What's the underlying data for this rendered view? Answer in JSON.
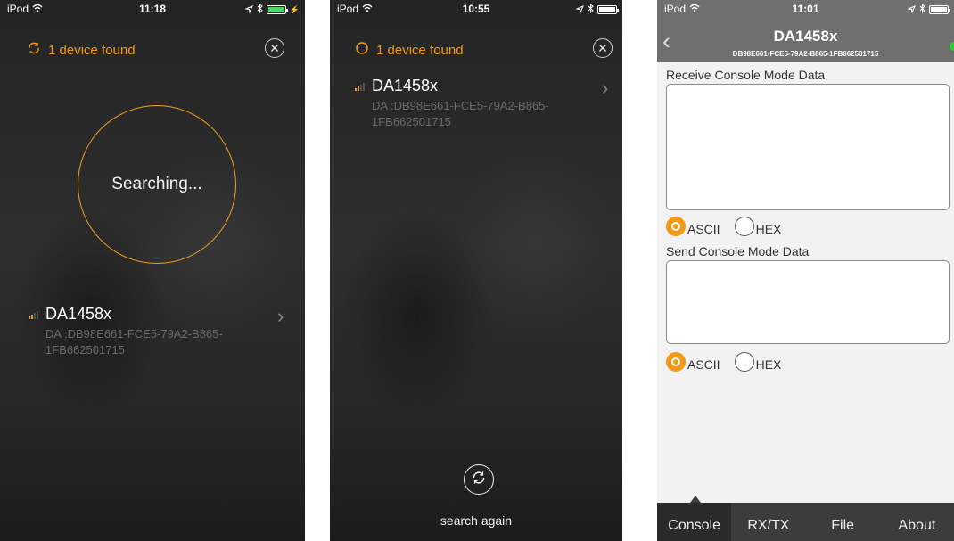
{
  "screen1": {
    "status": {
      "carrier": "iPod",
      "time": "11:18"
    },
    "found_text": "1 device found",
    "searching_text": "Searching...",
    "device": {
      "name": "DA1458x",
      "id": "DA :DB98E661-FCE5-79A2-B865-1FB662501715"
    }
  },
  "screen2": {
    "status": {
      "carrier": "iPod",
      "time": "10:55"
    },
    "found_text": "1 device found",
    "device": {
      "name": "DA1458x",
      "id": "DA :DB98E661-FCE5-79A2-B865-1FB662501715"
    },
    "search_again_label": "search again"
  },
  "screen3": {
    "status": {
      "carrier": "iPod",
      "time": "11:01"
    },
    "nav": {
      "title": "DA1458x",
      "subtitle": "DB98E661-FCE5-79A2-B865-1FB662501715"
    },
    "receive_label": "Receive Console Mode Data",
    "send_label": "Send Console Mode Data",
    "receive_format": {
      "ascii": "ASCII",
      "hex": "HEX",
      "selected": "ASCII"
    },
    "send_format": {
      "ascii": "ASCII",
      "hex": "HEX",
      "selected": "ASCII"
    },
    "receive_text": "",
    "send_text": "",
    "tabs": [
      {
        "label": "Console",
        "active": true
      },
      {
        "label": "RX/TX",
        "active": false
      },
      {
        "label": "File",
        "active": false
      },
      {
        "label": "About",
        "active": false
      }
    ]
  },
  "colors": {
    "accent": "#f39a1a",
    "connected": "#2bd12b",
    "nav_bg": "#6f6f6f",
    "tab_bg": "#3c3c3c"
  }
}
